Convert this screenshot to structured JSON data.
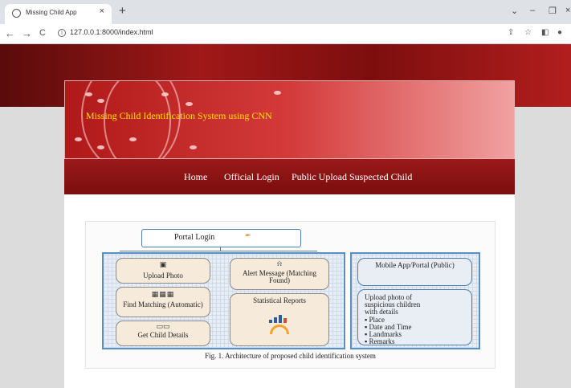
{
  "browser": {
    "tab_title": "Missing Child App",
    "tab_close": "×",
    "new_tab": "+",
    "url": "127.0.0.1:8000/index.html",
    "back": "←",
    "forward": "→",
    "reload": "C",
    "info": "i",
    "share": "⇪",
    "star": "☆",
    "sidepanel": "◧",
    "profile": "●",
    "controls": {
      "dropdown": "⌄",
      "minimize": "–",
      "restore": "❐",
      "close": "×"
    }
  },
  "banner": {
    "title": "Missing Child Identification System using CNN"
  },
  "nav": {
    "items": [
      {
        "label": "Home"
      },
      {
        "label": "Official Login"
      },
      {
        "label": "Public Upload Suspected Child"
      }
    ]
  },
  "figure": {
    "portal_login": "Portal Login",
    "cards": {
      "upload_photo": "Upload Photo",
      "find_matching": "Find Matching (Automatic)",
      "get_child_details": "Get Child Details",
      "alert_message": "Alert Message (Matching Found)",
      "statistical_reports": "Statistical Reports",
      "mobile_app": "Mobile App/Portal (Public)",
      "upload_suspicious": "Upload photo of suspicious children with details"
    },
    "bullets": [
      "Place",
      "Date and Time",
      "Landmarks",
      "Remarks"
    ],
    "caption": "Fig. 1.   Architecture of proposed child identification system"
  },
  "colors": {
    "banner_title": "#ffe100",
    "nav_bar": "#8b1414",
    "panel_border": "#5a8fc2"
  }
}
